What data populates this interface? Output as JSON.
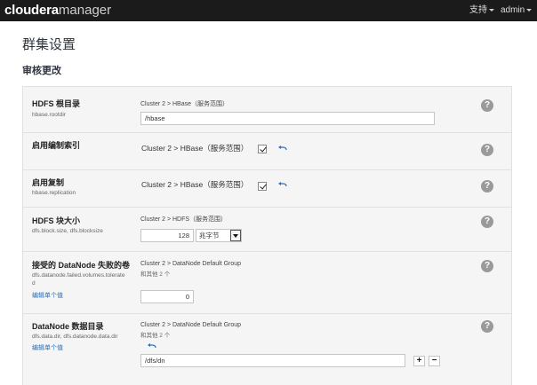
{
  "header": {
    "brand_main": "cloudera",
    "brand_product": "manager",
    "support_label": "支持",
    "user_label": "admin"
  },
  "page": {
    "title": "群集设置",
    "section_title": "审核更改"
  },
  "settings": [
    {
      "label": "HDFS 根目录",
      "key": "hbase.rootdir",
      "scope": "Cluster 2 > HBase（服务范围）",
      "value": "/hbase"
    },
    {
      "label": "启用编制索引",
      "scope": "Cluster 2 > HBase（服务范围）",
      "checked": true
    },
    {
      "label": "启用复制",
      "key": "hbase.replication",
      "scope": "Cluster 2 > HBase（服务范围）",
      "checked": true
    },
    {
      "label": "HDFS 块大小",
      "key": "dfs.block.size, dfs.blocksize",
      "scope": "Cluster 2 > HDFS（服务范围）",
      "value": "128",
      "unit": "兆字节"
    },
    {
      "label": "接受的 DataNode 失败的卷",
      "key_line1": "dfs.datanode.failed.volumes.tolerate",
      "key_line2": "d",
      "scope": "Cluster 2 > DataNode Default Group",
      "others": "和其他 2 个",
      "edit_link": "编辑单个值",
      "value": "0"
    },
    {
      "label": "DataNode 数据目录",
      "key": "dfs.data.dir, dfs.datanode.data.dir",
      "scope": "Cluster 2 > DataNode Default Group",
      "others": "和其他 2 个",
      "edit_link": "编辑单个值",
      "value": "/dfs/dn",
      "add_symbol": "+",
      "remove_symbol": "−"
    }
  ],
  "help_symbol": "?",
  "colors": {
    "topbar": "#1b1b1b",
    "panel": "#f5f5f5",
    "link": "#2a6fb8",
    "help": "#9a9a9a"
  }
}
